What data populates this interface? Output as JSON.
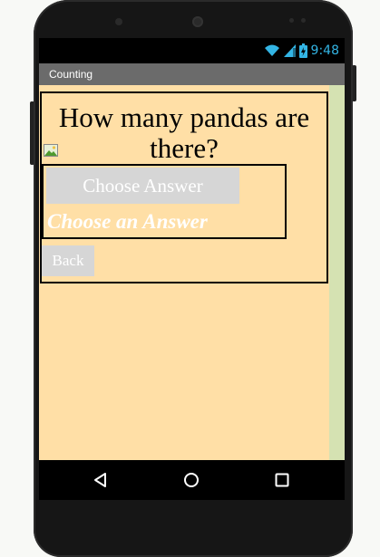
{
  "status_bar": {
    "time": "9:48",
    "icons": [
      "wifi-icon",
      "signal-icon",
      "battery-charging-icon"
    ],
    "accent_color": "#33b5e5"
  },
  "app": {
    "title": "Counting"
  },
  "main": {
    "question": "How many pandas are there?",
    "image_icon": "broken-image-icon",
    "choose_button_label": "Choose Answer",
    "choose_label": "Choose an Answer",
    "back_button_label": "Back",
    "background_color": "#ffdfa6",
    "button_color": "#d6d6d6"
  },
  "nav_bar": {
    "icons": [
      "back-triangle-icon",
      "home-circle-icon",
      "recent-apps-square-icon"
    ]
  }
}
